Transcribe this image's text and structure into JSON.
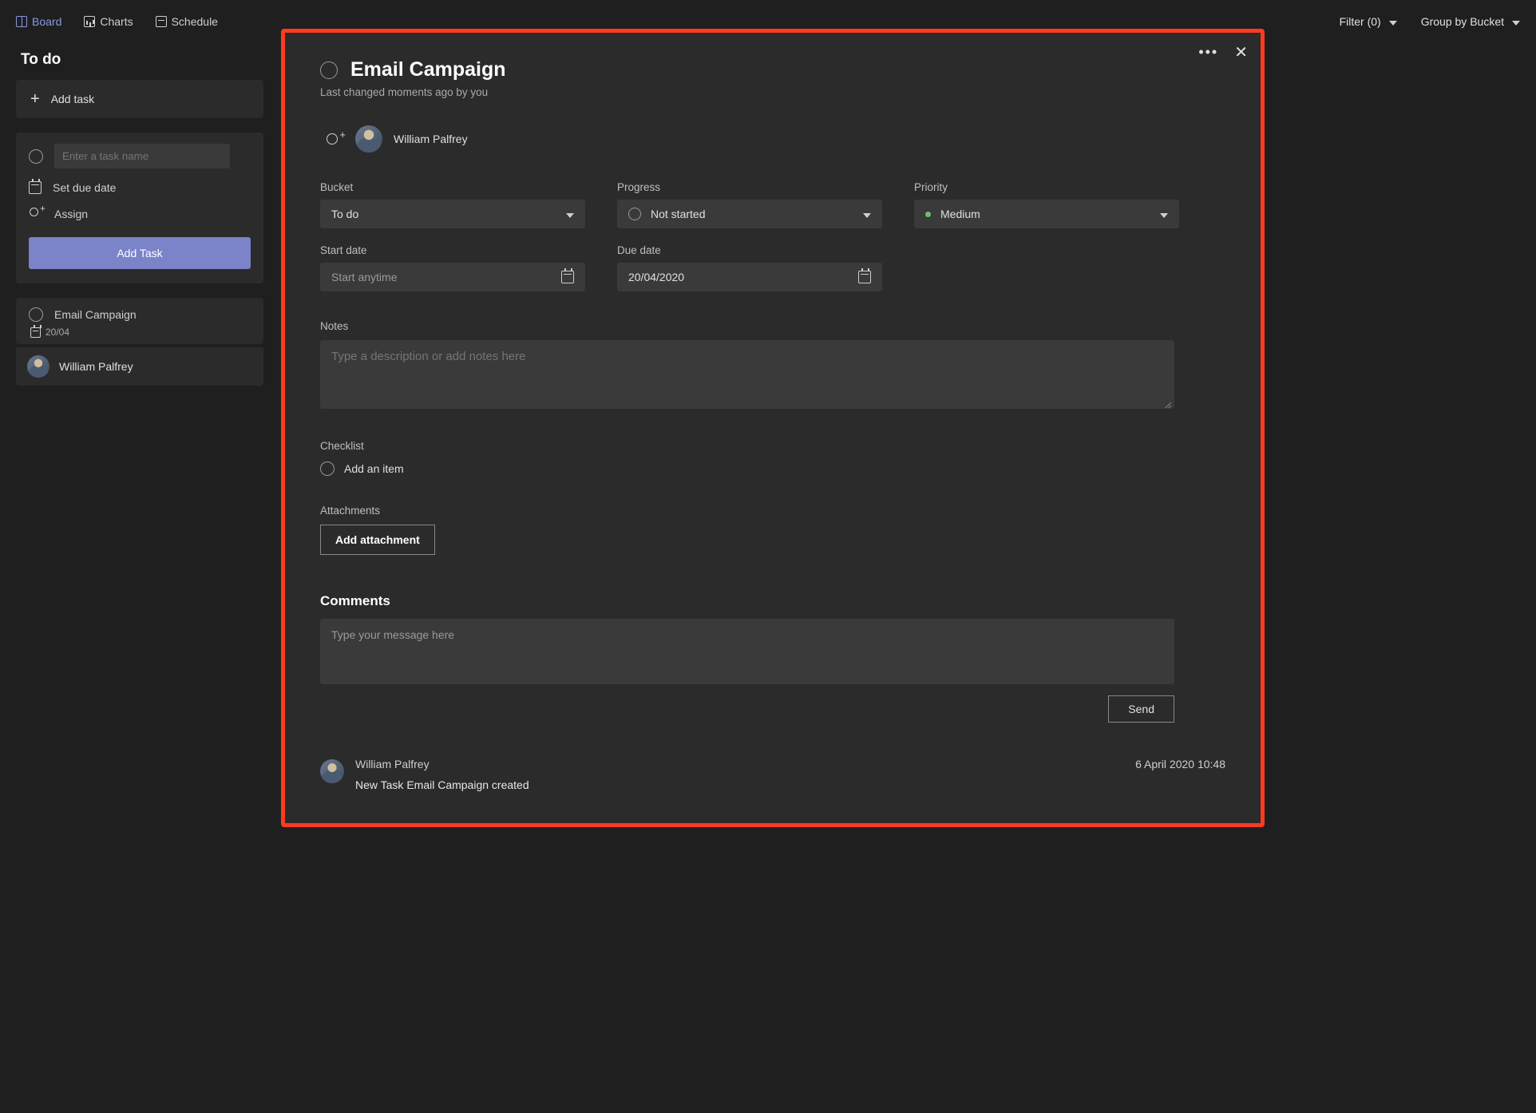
{
  "tabs": {
    "board": "Board",
    "charts": "Charts",
    "schedule": "Schedule"
  },
  "toolbar": {
    "filter": "Filter (0)",
    "group": "Group by Bucket"
  },
  "bucket": {
    "title": "To do",
    "add_task": "Add task",
    "enter_task_placeholder": "Enter a task name",
    "set_due_date": "Set due date",
    "assign": "Assign",
    "add_task_btn": "Add Task"
  },
  "card": {
    "title": "Email Campaign",
    "date": "20/04",
    "assignee": "William Palfrey"
  },
  "swatch_colors": [
    "#e9b9f2",
    "#f4b9c3",
    "#f2edb2",
    "#bdeec1",
    "#bcd9f5",
    "#d9c7f2"
  ],
  "modal": {
    "title": "Email Campaign",
    "subtitle": "Last changed moments ago by you",
    "assignee": "William Palfrey",
    "fields": {
      "bucket_label": "Bucket",
      "bucket_value": "To do",
      "progress_label": "Progress",
      "progress_value": "Not started",
      "priority_label": "Priority",
      "priority_value": "Medium",
      "start_label": "Start date",
      "start_placeholder": "Start anytime",
      "due_label": "Due date",
      "due_value": "20/04/2020"
    },
    "notes_label": "Notes",
    "notes_placeholder": "Type a description or add notes here",
    "checklist_label": "Checklist",
    "checklist_add": "Add an item",
    "attachments_label": "Attachments",
    "add_attachment": "Add attachment",
    "comments_label": "Comments",
    "comment_placeholder": "Type your message here",
    "send": "Send",
    "activity": {
      "author": "William Palfrey",
      "time": "6 April 2020 10:48",
      "message": "New Task Email Campaign created"
    }
  }
}
